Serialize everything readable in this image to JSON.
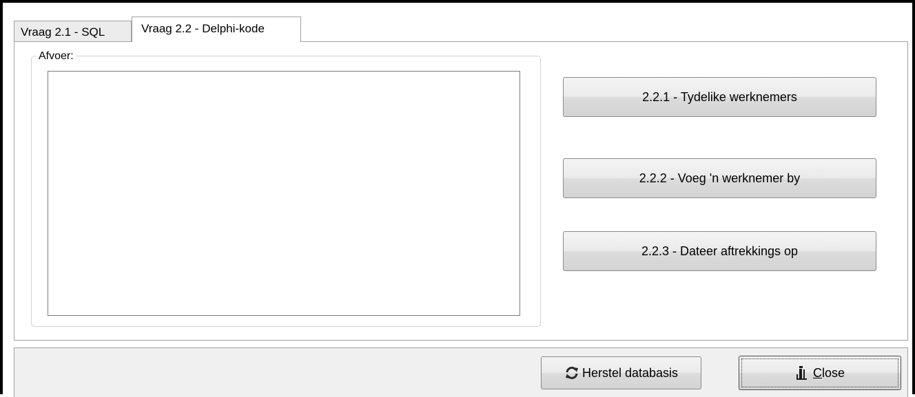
{
  "tabs": [
    {
      "label": "Vraag 2.1 - SQL",
      "active": false
    },
    {
      "label": "Vraag 2.2 - Delphi-kode",
      "active": true
    }
  ],
  "output_group": {
    "caption": "Afvoer:",
    "memo_text": ""
  },
  "actions": [
    {
      "label": "2.2.1 - Tydelike werknemers"
    },
    {
      "label": "2.2.2 - Voeg 'n werknemer by"
    },
    {
      "label": "2.2.3 - Dateer aftrekkings op"
    }
  ],
  "footer": {
    "restore_label": "Herstel databasis",
    "restore_icon": "refresh-icon",
    "close_label_accel": "C",
    "close_label_rest": "lose",
    "close_icon": "door-exit-icon"
  }
}
